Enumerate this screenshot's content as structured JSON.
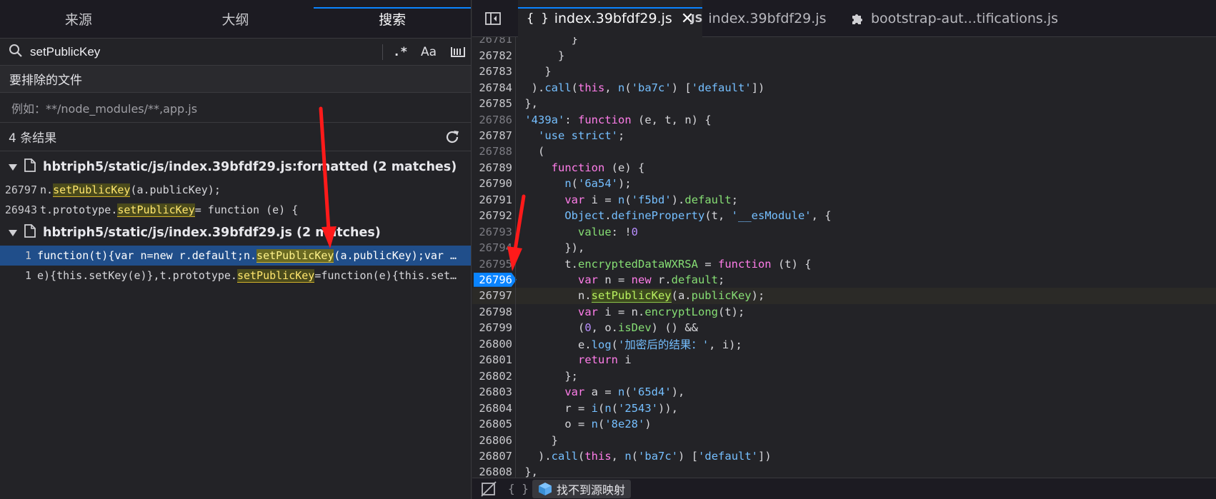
{
  "left_tabs": [
    "来源",
    "大纲",
    "搜索"
  ],
  "search": {
    "query": "setPublicKey",
    "opt_regex": ".*",
    "opt_case": "Aa",
    "exclude_label": "要排除的文件",
    "exclude_placeholder": "例如：**/node_modules/**,app.js",
    "result_count": "4 条结果"
  },
  "results": [
    {
      "file": "hbtriph5/static/js/index.39bfdf29.js:formatted (2 matches)",
      "matches": [
        {
          "line": "26797",
          "pre": "n.",
          "hit": "setPublicKey",
          "post": "(a.publicKey);"
        },
        {
          "line": "26943",
          "pre": "t.prototype.",
          "hit": "setPublicKey",
          "post": " = function (e) {"
        }
      ]
    },
    {
      "file": "hbtriph5/static/js/index.39bfdf29.js (2 matches)",
      "matches": [
        {
          "line": "1",
          "pre": "function(t){var n=new r.default;n.",
          "hit": "setPublicKey",
          "post": "(a.publicKey);var …",
          "selected": true
        },
        {
          "line": "1",
          "pre": "e){this.setKey(e)},t.prototype.",
          "hit": "setPublicKey",
          "post": "=function(e){this.set…"
        }
      ]
    }
  ],
  "editor_tabs": [
    {
      "icon": "{ }",
      "label": "index.39bfdf29.js",
      "active": true,
      "closable": true
    },
    {
      "icon": "JS",
      "label": "index.39bfdf29.js",
      "active": false
    },
    {
      "icon": "puzzle",
      "label": "bootstrap-aut...tifications.js",
      "active": false
    }
  ],
  "code_lines": [
    {
      "n": "26781",
      "html": "        }",
      "dim": true
    },
    {
      "n": "26782",
      "html": "      }"
    },
    {
      "n": "26783",
      "html": "    }"
    },
    {
      "n": "26784",
      "html": "  ).<span class=\"f\">call</span>(<span class=\"k\">this</span>, <span class=\"f\">n</span>(<span class=\"st\">'ba7c'</span>) [<span class=\"st\">'default'</span>])"
    },
    {
      "n": "26785",
      "html": " },"
    },
    {
      "n": "26786",
      "html": " <span class=\"st\">'439a'</span>: <span class=\"k\">function</span> (e, t, n) {",
      "dim": true
    },
    {
      "n": "26787",
      "html": "   <span class=\"st\">'use strict'</span>;"
    },
    {
      "n": "26788",
      "html": "   (",
      "dim": true
    },
    {
      "n": "26789",
      "html": "     <span class=\"k\">function</span> (e) {"
    },
    {
      "n": "26790",
      "html": "       <span class=\"f\">n</span>(<span class=\"st\">'6a54'</span>);"
    },
    {
      "n": "26791",
      "html": "       <span class=\"k\">var</span> i = <span class=\"f\">n</span>(<span class=\"st\">'f5bd'</span>).<span class=\"s\">default</span>;"
    },
    {
      "n": "26792",
      "html": "       <span class=\"f\">Object</span>.<span class=\"f\">defineProperty</span>(t, <span class=\"st\">'__esModule'</span>, {"
    },
    {
      "n": "26793",
      "html": "         <span class=\"s\">value</span>: !<span class=\"p\">0</span>",
      "dim": true
    },
    {
      "n": "26794",
      "html": "       }),",
      "dim": true
    },
    {
      "n": "26795",
      "html": "       t.<span class=\"s\">encryptedDataWXRSA</span> = <span class=\"k\">function</span> (t) {",
      "dim": true
    },
    {
      "n": "26796",
      "html": "         <span class=\"k\">var</span> n = <span class=\"k\">new</span> r.<span class=\"s\">default</span>;",
      "bp": true
    },
    {
      "n": "26797",
      "html": "         n.<span class=\"lh\">setPublicKey</span>(a.<span class=\"s\">publicKey</span>);",
      "current": true
    },
    {
      "n": "26798",
      "html": "         <span class=\"k\">var</span> i = n.<span class=\"s\">encryptLong</span>(t);"
    },
    {
      "n": "26799",
      "html": "         (<span class=\"p\">0</span>, o.<span class=\"s\">isDev</span>) () &amp;&amp;"
    },
    {
      "n": "26800",
      "html": "         e.<span class=\"f\">log</span>(<span class=\"st\">'加密后的结果：'</span>, i);"
    },
    {
      "n": "26801",
      "html": "         <span class=\"k\">return</span> i"
    },
    {
      "n": "26802",
      "html": "       };"
    },
    {
      "n": "26803",
      "html": "       <span class=\"k\">var</span> a = <span class=\"f\">n</span>(<span class=\"st\">'65d4'</span>),"
    },
    {
      "n": "26804",
      "html": "       r = <span class=\"f\">i</span>(<span class=\"f\">n</span>(<span class=\"st\">'2543'</span>)),"
    },
    {
      "n": "26805",
      "html": "       o = <span class=\"f\">n</span>(<span class=\"st\">'8e28'</span>)"
    },
    {
      "n": "26806",
      "html": "     }"
    },
    {
      "n": "26807",
      "html": "   ).<span class=\"f\">call</span>(<span class=\"k\">this</span>, <span class=\"f\">n</span>(<span class=\"st\">'ba7c'</span>) [<span class=\"st\">'default'</span>])"
    },
    {
      "n": "26808",
      "html": " },"
    }
  ],
  "status": {
    "pretty_print": "{ }",
    "sourcemap_label": "找不到源映射"
  }
}
